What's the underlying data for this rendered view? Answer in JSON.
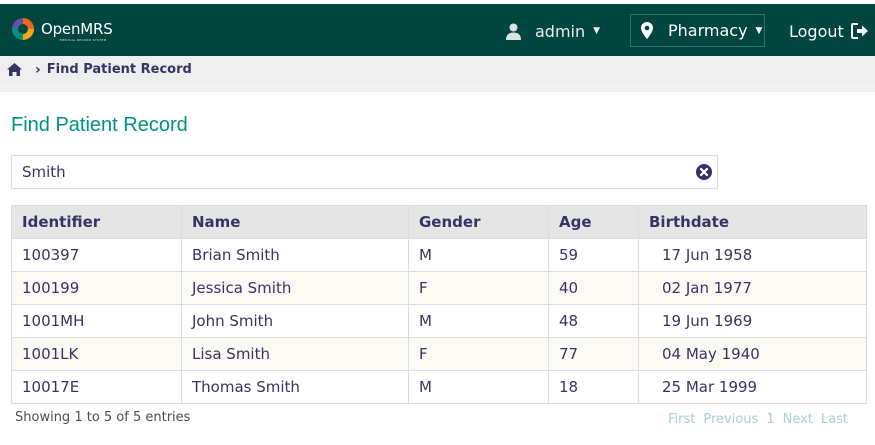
{
  "app": {
    "brand": "OpenMRS",
    "brand_sub": "MEDICAL RECORD SYSTEM"
  },
  "header": {
    "user": "admin",
    "location": "Pharmacy",
    "logout": "Logout"
  },
  "breadcrumb": {
    "current": "Find Patient Record"
  },
  "page": {
    "title": "Find Patient Record"
  },
  "search": {
    "value": "Smith"
  },
  "table": {
    "columns": [
      "Identifier",
      "Name",
      "Gender",
      "Age",
      "Birthdate"
    ],
    "rows": [
      {
        "identifier": "100397",
        "name": "Brian Smith",
        "gender": "M",
        "age": "59",
        "birthdate": "17 Jun 1958"
      },
      {
        "identifier": "100199",
        "name": "Jessica Smith",
        "gender": "F",
        "age": "40",
        "birthdate": "02 Jan 1977"
      },
      {
        "identifier": "1001MH",
        "name": "John Smith",
        "gender": "M",
        "age": "48",
        "birthdate": "19 Jun 1969"
      },
      {
        "identifier": "1001LK",
        "name": "Lisa Smith",
        "gender": "F",
        "age": "77",
        "birthdate": "04 May 1940"
      },
      {
        "identifier": "10017E",
        "name": "Thomas Smith",
        "gender": "M",
        "age": "18",
        "birthdate": "25 Mar 1999"
      }
    ]
  },
  "footer": {
    "info": "Showing 1 to 5 of 5 entries",
    "pager": {
      "first": "First",
      "previous": "Previous",
      "page": "1",
      "next": "Next",
      "last": "Last"
    }
  },
  "colors": {
    "header_bg": "#00463f",
    "accent": "#009384",
    "text": "#363463",
    "pager_disabled": "#a7cfe0"
  }
}
